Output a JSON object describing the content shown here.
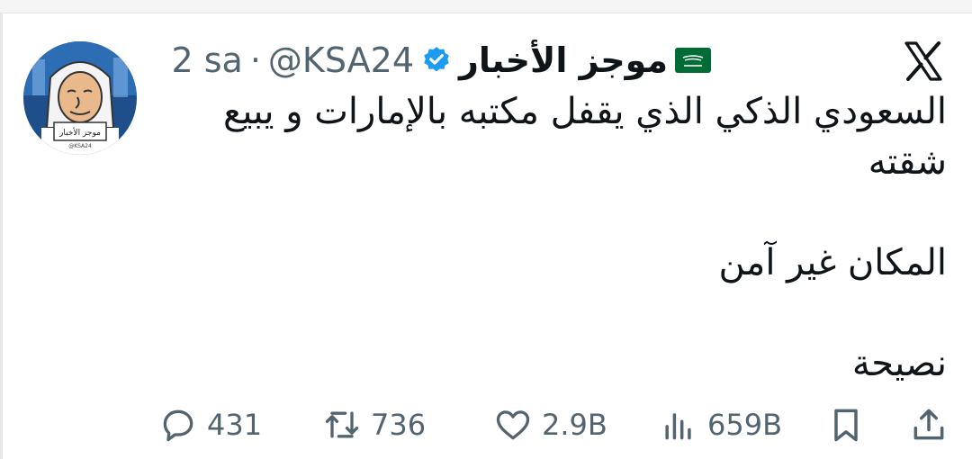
{
  "tweet": {
    "display_name": "موجز الأخبار",
    "handle": "@KSA24",
    "separator": "·",
    "time": "2 sa",
    "lines": [
      "السعودي الذكي الذي يقفل مكتبه بالإمارات و يبيع",
      "شقته",
      "المكان غير آمن",
      "نصيحة"
    ]
  },
  "avatar": {
    "caption_text": "موجز الأخبار",
    "caption_handle": "@KSA24"
  },
  "actions": {
    "replies": "431",
    "retweets": "736",
    "likes": "2.9B",
    "views": "659B"
  },
  "icons": {
    "platform_logo": "x-logo-icon",
    "verified": "verified-badge-icon",
    "flag": "saudi-flag-icon",
    "reply": "reply-icon",
    "retweet": "retweet-icon",
    "like": "heart-icon",
    "views": "views-bar-chart-icon",
    "bookmark": "bookmark-icon",
    "share": "share-icon"
  },
  "colors": {
    "text": "#0f1419",
    "secondary": "#536471",
    "verified_blue": "#1d9bf0",
    "flag_green": "#006c35"
  }
}
